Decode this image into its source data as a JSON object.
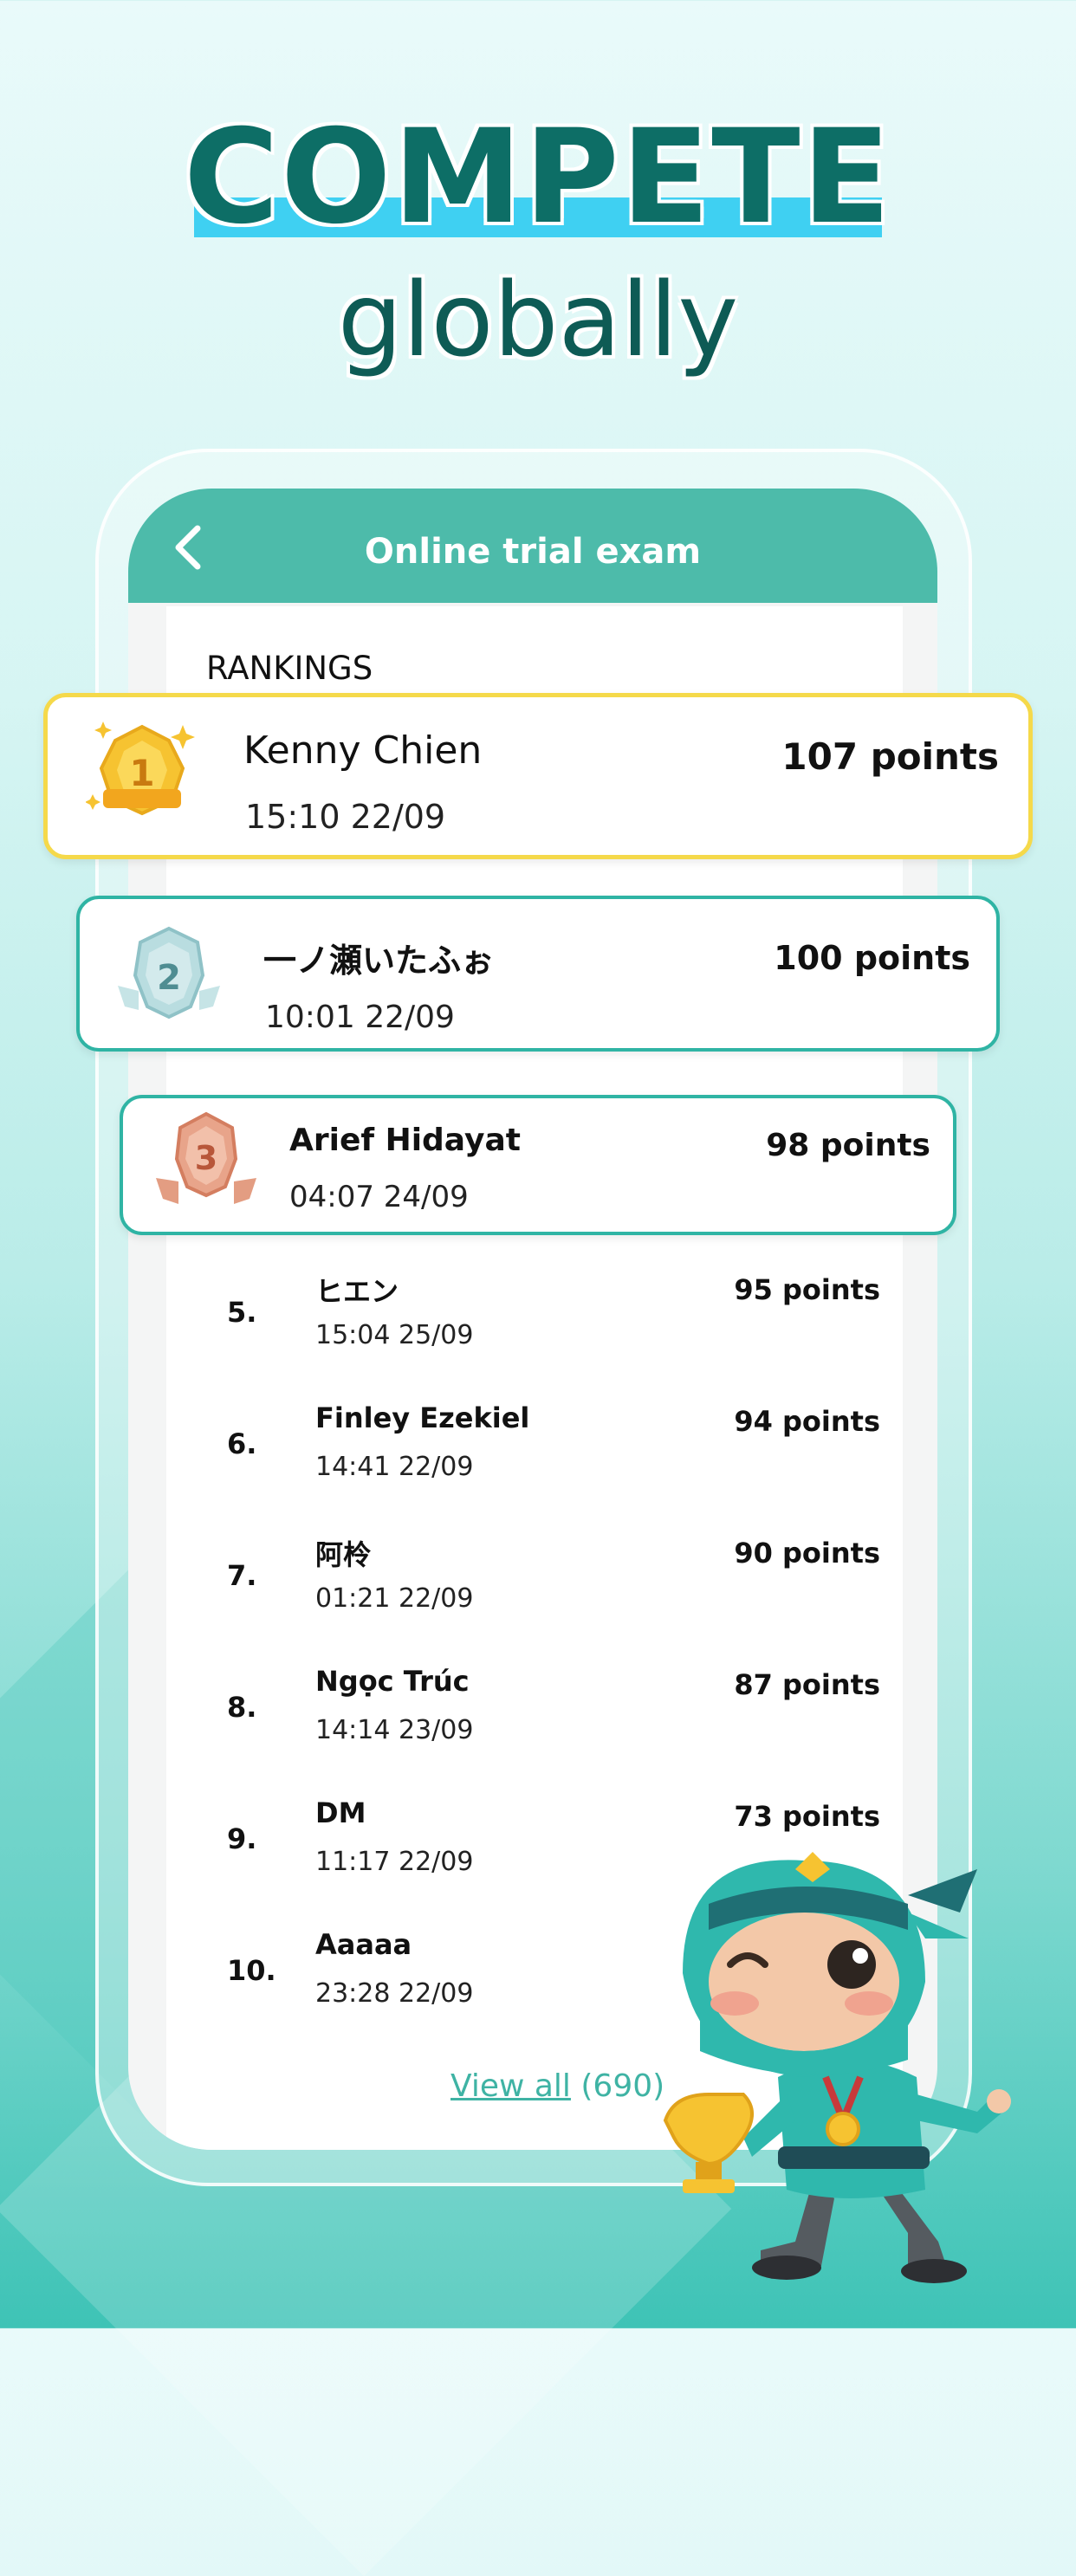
{
  "promo": {
    "headline": "COMPETE",
    "subheadline": "globally"
  },
  "app": {
    "title": "Online trial exam",
    "section_title": "RANKINGS",
    "back_icon": "chevron-left-icon"
  },
  "podium": [
    {
      "rank": "1",
      "name": "Kenny Chien",
      "time": "15:10 22/09",
      "points": "107 points",
      "medal_color": "#f6c331"
    },
    {
      "rank": "2",
      "name": "一ノ瀬いたふぉ",
      "time": "10:01 22/09",
      "points": "100 points",
      "medal_color": "#a9d2d6"
    },
    {
      "rank": "3",
      "name": "Arief Hidayat",
      "time": "04:07 24/09",
      "points": "98 points",
      "medal_color": "#e59a7f"
    }
  ],
  "rankings": [
    {
      "rank": "5.",
      "name": "ヒエン",
      "time": "15:04 25/09",
      "points": "95 points"
    },
    {
      "rank": "6.",
      "name": "Finley Ezekiel",
      "time": "14:41 22/09",
      "points": "94 points"
    },
    {
      "rank": "7.",
      "name": "阿柃",
      "time": "01:21 22/09",
      "points": "90 points"
    },
    {
      "rank": "8.",
      "name": "Ngọc Trúc",
      "time": "14:14 23/09",
      "points": "87 points"
    },
    {
      "rank": "9.",
      "name": "DM",
      "time": "11:17 22/09",
      "points": "73 points"
    },
    {
      "rank": "10.",
      "name": "Aaaaa",
      "time": "23:28 22/09",
      "points": ""
    }
  ],
  "view_all": {
    "label": "View all",
    "count": "(690)"
  },
  "colors": {
    "primary": "#4dbbaa",
    "headline": "#0d6e66",
    "highlight_bar": "#3fd0f2",
    "gold_border": "#f5d94a",
    "teal_border": "#2fb4a4"
  }
}
